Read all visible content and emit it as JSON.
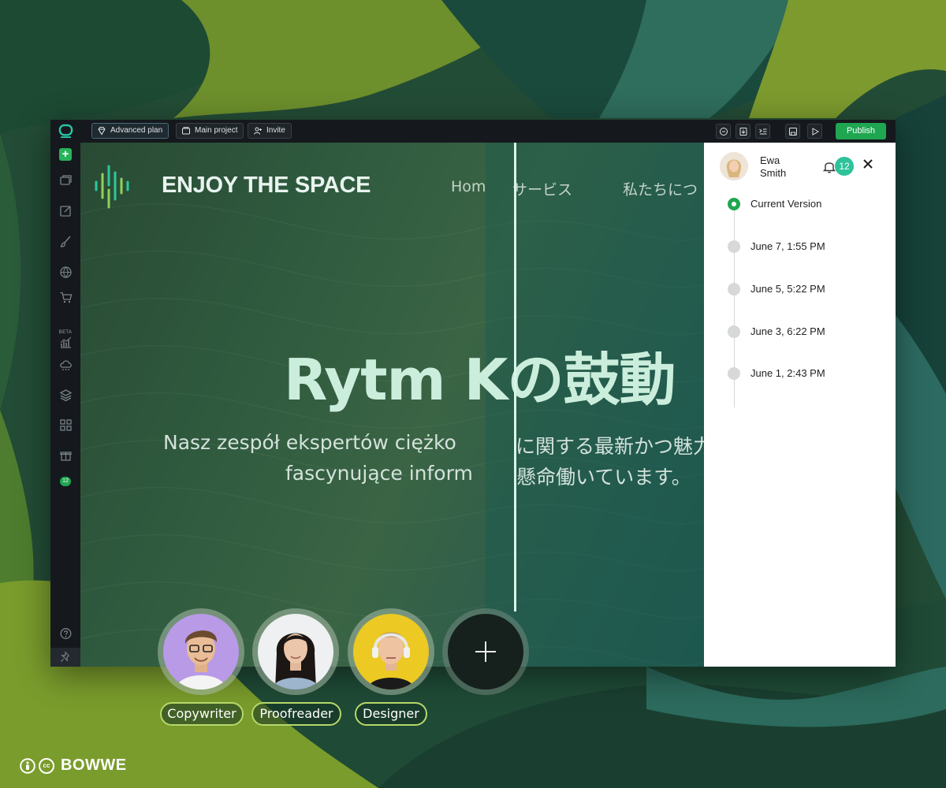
{
  "toolbar": {
    "plan_label": "Advanced plan",
    "project_label": "Main project",
    "invite_label": "Invite",
    "publish_label": "Publish"
  },
  "sidebar": {
    "beta_label": "BETA",
    "badge_count": "12"
  },
  "site": {
    "brand": "ENJOY THE SPACE",
    "nav": [
      "Hom",
      "サービス",
      "私たちにつ"
    ],
    "hero_left": "Rytm K",
    "hero_right": "の鼓動",
    "sub_line1_left": "Nasz zespół ekspertów ciężko",
    "sub_line1_right": "に関する最新かつ魅力",
    "sub_line2_left": "fascynujące inform",
    "sub_line2_right": "懸命働いています。"
  },
  "panel": {
    "user_first": "Ewa",
    "user_last": "Smith",
    "notifications": "12",
    "versions": [
      {
        "label": "Current Version",
        "current": true
      },
      {
        "label": "June 7, 1:55 PM",
        "current": false
      },
      {
        "label": "June 5, 5:22 PM",
        "current": false
      },
      {
        "label": "June 3, 6:22 PM",
        "current": false
      },
      {
        "label": "June 1, 2:43 PM",
        "current": false
      }
    ]
  },
  "team": {
    "roles": [
      "Copywriter",
      "Proofreader",
      "Designer"
    ]
  },
  "footer": {
    "brand": "BOWWE",
    "cc": "cc"
  },
  "colors": {
    "accent_green": "#1fa651",
    "badge_teal": "#2ec29a",
    "role_border": "#b5d86a"
  }
}
